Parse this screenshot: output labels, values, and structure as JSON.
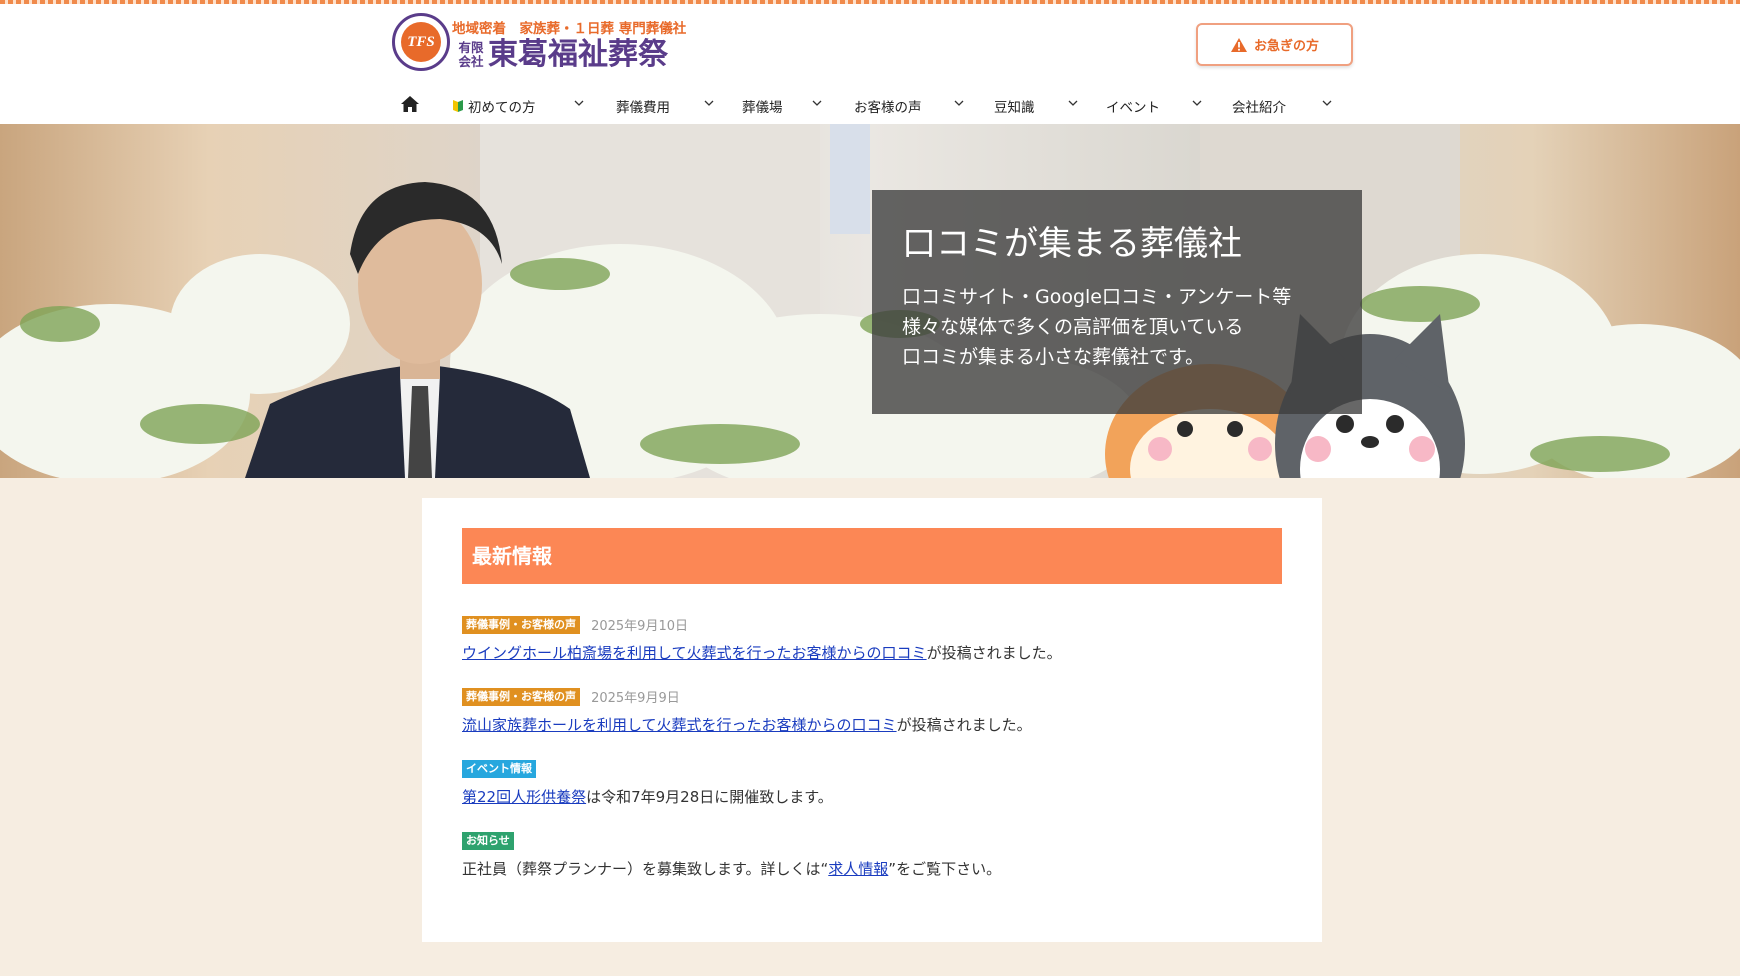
{
  "logo": {
    "emblem": "TFS",
    "tagline": "地域密着　家族葬・１日葬 専門葬儀社",
    "type": "有限会社",
    "name": "東葛福祉葬祭"
  },
  "header": {
    "urgent_label": "お急ぎの方",
    "urgent_icon": "warning-icon"
  },
  "nav": {
    "home_icon": "home-icon",
    "items": [
      {
        "label": "初めての方"
      },
      {
        "label": "葬儀費用"
      },
      {
        "label": "葬儀場"
      },
      {
        "label": "お客様の声"
      },
      {
        "label": "豆知識"
      },
      {
        "label": "イベント"
      },
      {
        "label": "会社紹介"
      }
    ]
  },
  "hero": {
    "title": "口コミが集まる葬儀社",
    "lines": [
      "口コミサイト・Google口コミ・アンケート等",
      "様々な媒体で多くの高評価を頂いている",
      "口コミが集まる小さな葬儀社です。"
    ]
  },
  "news": {
    "heading": "最新情報",
    "entries": [
      {
        "tag": "葬儀事例・お客様の声",
        "date": "2025年9月10日",
        "pre": "",
        "link": "ウイングホール柏斎場を利用して火葬式を行ったお客様からの口コミ",
        "post": "が投稿されました。"
      },
      {
        "tag": "葬儀事例・お客様の声",
        "date": "2025年9月9日",
        "pre": "",
        "link": "流山家族葬ホールを利用して火葬式を行ったお客様からの口コミ",
        "post": "が投稿されました。"
      },
      {
        "tag": "イベント情報",
        "date": "",
        "pre": "",
        "link": "第22回人形供養祭",
        "post": "は令和7年9月28日に開催致します。"
      },
      {
        "tag": "お知らせ",
        "date": "",
        "pre": "正社員（葬祭プランナー）を募集致します。詳しくは“",
        "link": "求人情報",
        "post": "”をご覧下さい。"
      }
    ]
  },
  "colors": {
    "accent": "#fc8755",
    "brand_purple": "#5a3c8a",
    "brand_orange": "#e86a2a",
    "link": "#1a3cbf"
  }
}
